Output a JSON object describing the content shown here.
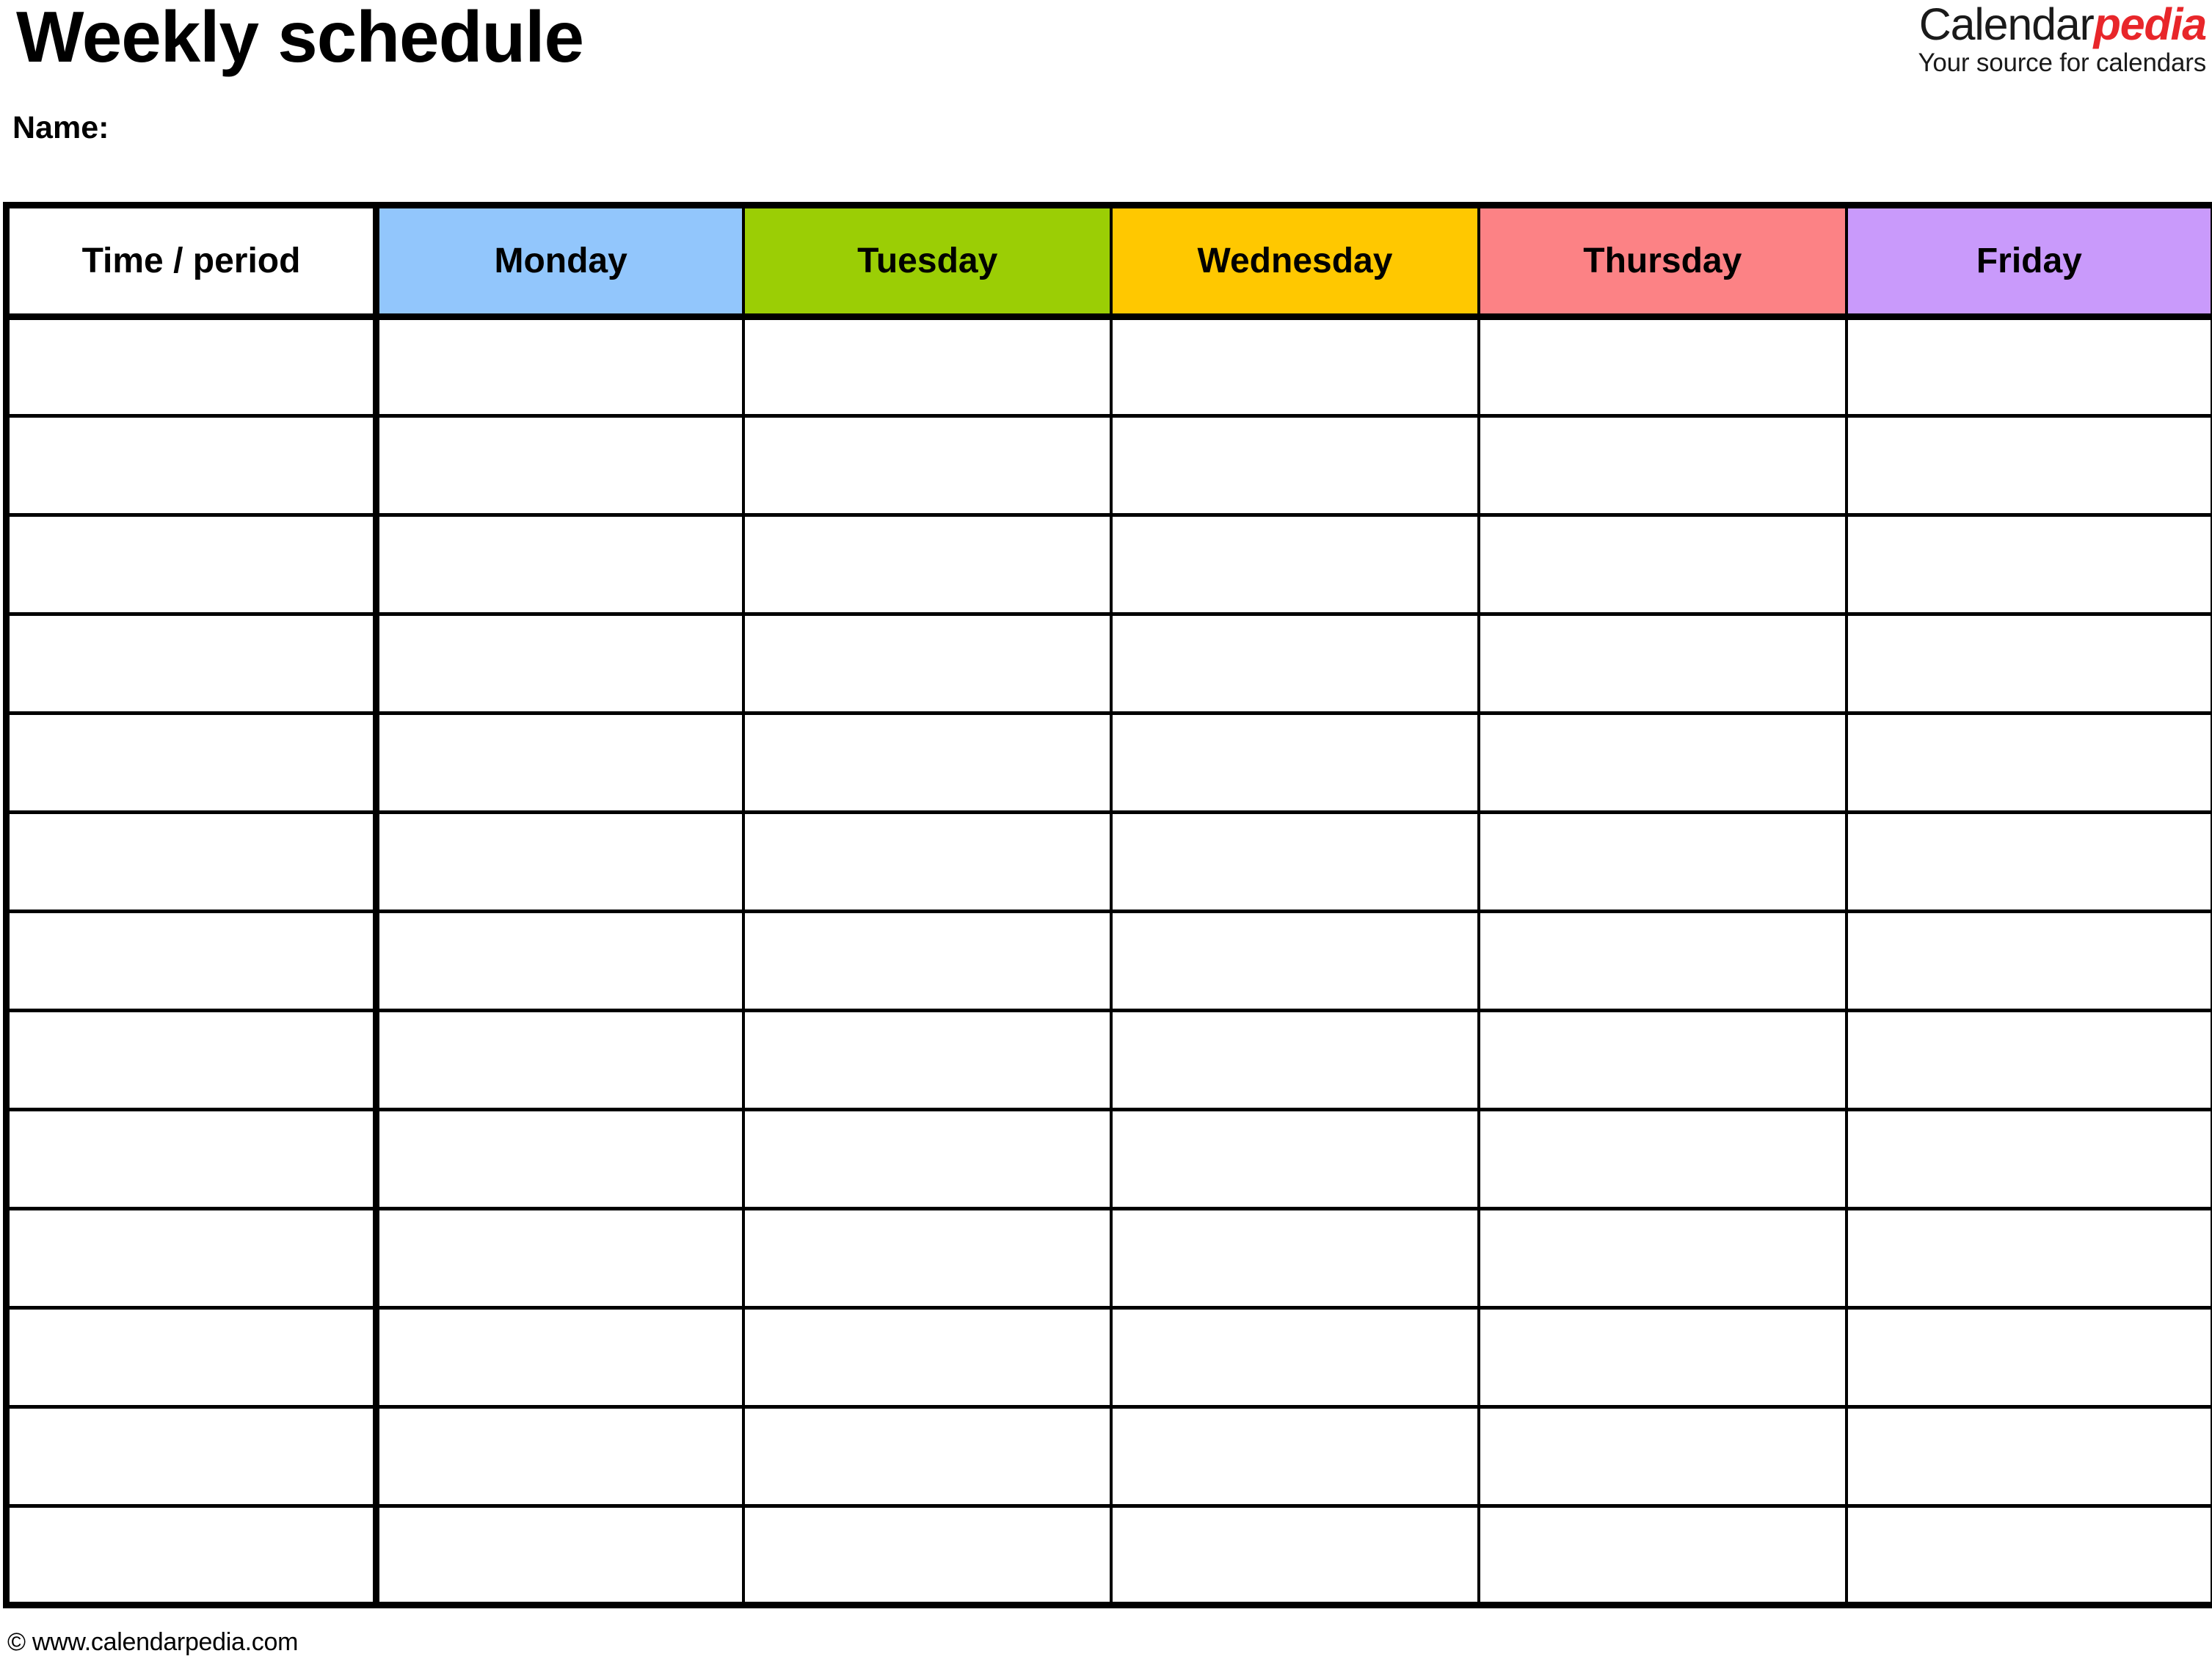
{
  "document": {
    "title": "Weekly schedule",
    "name_label": "Name:"
  },
  "brand": {
    "word_primary": "Calendar",
    "word_accent": "pedia",
    "tagline": "Your source for calendars",
    "accent_color": "#e8262a",
    "primary_color": "#1a1a1a"
  },
  "table": {
    "columns": [
      {
        "label": "Time / period",
        "bg": "#ffffff",
        "key": "time"
      },
      {
        "label": "Monday",
        "bg": "#92c6fc",
        "key": "monday"
      },
      {
        "label": "Tuesday",
        "bg": "#9bce05",
        "key": "tuesday"
      },
      {
        "label": "Wednesday",
        "bg": "#ffc800",
        "key": "wednesday"
      },
      {
        "label": "Thursday",
        "bg": "#fc8285",
        "key": "thursday"
      },
      {
        "label": "Friday",
        "bg": "#c99afb",
        "key": "friday"
      }
    ],
    "row_count": 13,
    "rows": [
      {
        "time": "",
        "monday": "",
        "tuesday": "",
        "wednesday": "",
        "thursday": "",
        "friday": ""
      },
      {
        "time": "",
        "monday": "",
        "tuesday": "",
        "wednesday": "",
        "thursday": "",
        "friday": ""
      },
      {
        "time": "",
        "monday": "",
        "tuesday": "",
        "wednesday": "",
        "thursday": "",
        "friday": ""
      },
      {
        "time": "",
        "monday": "",
        "tuesday": "",
        "wednesday": "",
        "thursday": "",
        "friday": ""
      },
      {
        "time": "",
        "monday": "",
        "tuesday": "",
        "wednesday": "",
        "thursday": "",
        "friday": ""
      },
      {
        "time": "",
        "monday": "",
        "tuesday": "",
        "wednesday": "",
        "thursday": "",
        "friday": ""
      },
      {
        "time": "",
        "monday": "",
        "tuesday": "",
        "wednesday": "",
        "thursday": "",
        "friday": ""
      },
      {
        "time": "",
        "monday": "",
        "tuesday": "",
        "wednesday": "",
        "thursday": "",
        "friday": ""
      },
      {
        "time": "",
        "monday": "",
        "tuesday": "",
        "wednesday": "",
        "thursday": "",
        "friday": ""
      },
      {
        "time": "",
        "monday": "",
        "tuesday": "",
        "wednesday": "",
        "thursday": "",
        "friday": ""
      },
      {
        "time": "",
        "monday": "",
        "tuesday": "",
        "wednesday": "",
        "thursday": "",
        "friday": ""
      },
      {
        "time": "",
        "monday": "",
        "tuesday": "",
        "wednesday": "",
        "thursday": "",
        "friday": ""
      },
      {
        "time": "",
        "monday": "",
        "tuesday": "",
        "wednesday": "",
        "thursday": "",
        "friday": ""
      }
    ],
    "border_color": "#000000"
  },
  "footer": {
    "copyright": "© www.calendarpedia.com"
  }
}
